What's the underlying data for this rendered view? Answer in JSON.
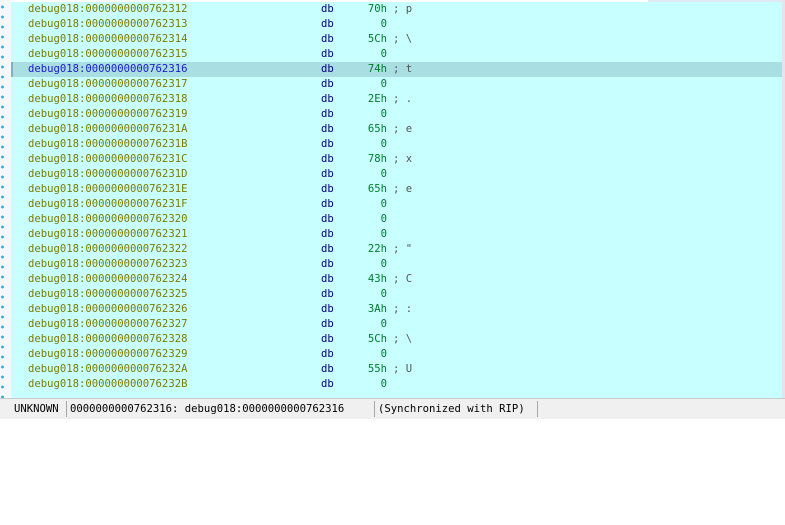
{
  "listing": {
    "current_index": 4,
    "rows": [
      {
        "address": "debug018:0000000000762312",
        "mnemonic": "db",
        "value": "70h",
        "comment": "; p"
      },
      {
        "address": "debug018:0000000000762313",
        "mnemonic": "db",
        "value": "0",
        "comment": ""
      },
      {
        "address": "debug018:0000000000762314",
        "mnemonic": "db",
        "value": "5Ch",
        "comment": "; \\"
      },
      {
        "address": "debug018:0000000000762315",
        "mnemonic": "db",
        "value": "0",
        "comment": ""
      },
      {
        "address": "debug018:0000000000762316",
        "mnemonic": "db",
        "value": "74h",
        "comment": "; t"
      },
      {
        "address": "debug018:0000000000762317",
        "mnemonic": "db",
        "value": "0",
        "comment": ""
      },
      {
        "address": "debug018:0000000000762318",
        "mnemonic": "db",
        "value": "2Eh",
        "comment": "; ."
      },
      {
        "address": "debug018:0000000000762319",
        "mnemonic": "db",
        "value": "0",
        "comment": ""
      },
      {
        "address": "debug018:000000000076231A",
        "mnemonic": "db",
        "value": "65h",
        "comment": "; e"
      },
      {
        "address": "debug018:000000000076231B",
        "mnemonic": "db",
        "value": "0",
        "comment": ""
      },
      {
        "address": "debug018:000000000076231C",
        "mnemonic": "db",
        "value": "78h",
        "comment": "; x"
      },
      {
        "address": "debug018:000000000076231D",
        "mnemonic": "db",
        "value": "0",
        "comment": ""
      },
      {
        "address": "debug018:000000000076231E",
        "mnemonic": "db",
        "value": "65h",
        "comment": "; e"
      },
      {
        "address": "debug018:000000000076231F",
        "mnemonic": "db",
        "value": "0",
        "comment": ""
      },
      {
        "address": "debug018:0000000000762320",
        "mnemonic": "db",
        "value": "0",
        "comment": ""
      },
      {
        "address": "debug018:0000000000762321",
        "mnemonic": "db",
        "value": "0",
        "comment": ""
      },
      {
        "address": "debug018:0000000000762322",
        "mnemonic": "db",
        "value": "22h",
        "comment": "; \""
      },
      {
        "address": "debug018:0000000000762323",
        "mnemonic": "db",
        "value": "0",
        "comment": ""
      },
      {
        "address": "debug018:0000000000762324",
        "mnemonic": "db",
        "value": "43h",
        "comment": "; C"
      },
      {
        "address": "debug018:0000000000762325",
        "mnemonic": "db",
        "value": "0",
        "comment": ""
      },
      {
        "address": "debug018:0000000000762326",
        "mnemonic": "db",
        "value": "3Ah",
        "comment": "; :"
      },
      {
        "address": "debug018:0000000000762327",
        "mnemonic": "db",
        "value": "0",
        "comment": ""
      },
      {
        "address": "debug018:0000000000762328",
        "mnemonic": "db",
        "value": "5Ch",
        "comment": "; \\"
      },
      {
        "address": "debug018:0000000000762329",
        "mnemonic": "db",
        "value": "0",
        "comment": ""
      },
      {
        "address": "debug018:000000000076232A",
        "mnemonic": "db",
        "value": "55h",
        "comment": "; U"
      },
      {
        "address": "debug018:000000000076232B",
        "mnemonic": "db",
        "value": "0",
        "comment": ""
      }
    ]
  },
  "status": {
    "segment_type": "UNKNOWN",
    "location": "0000000000762316: debug018:0000000000762316",
    "sync": "(Synchronized with RIP)"
  },
  "colors": {
    "listing_bg": "#c8ffff",
    "current_line_bg": "#a9dfe3",
    "address": "#7b7b00",
    "current_address": "#1a1acc",
    "mnemonic": "#000080",
    "value": "#007a2e"
  }
}
